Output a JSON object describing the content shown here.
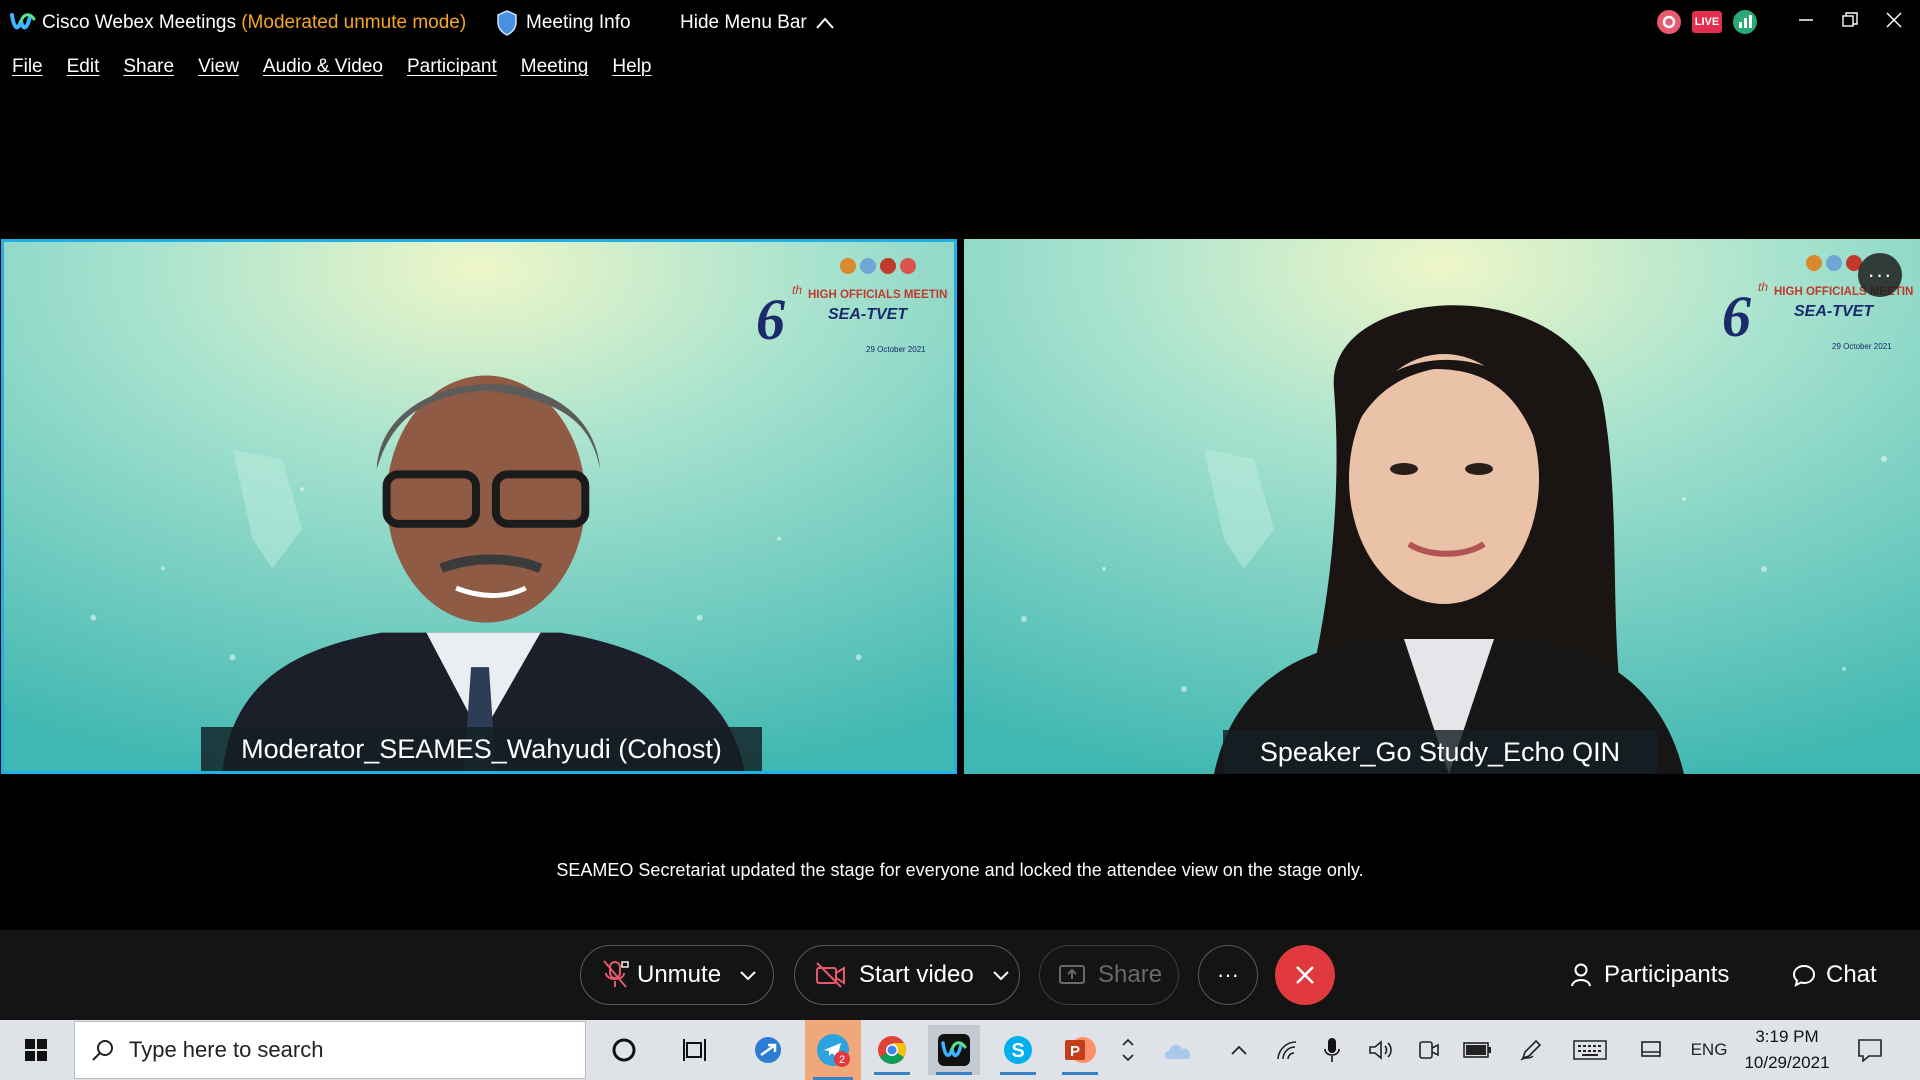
{
  "titlebar": {
    "app_name": "Cisco Webex Meetings",
    "mode": "(Moderated unmute mode)",
    "meeting_info": "Meeting Info",
    "hide_menu_bar": "Hide Menu Bar",
    "live_badge": "LIVE",
    "icons": [
      "webex-logo-icon",
      "shield-icon",
      "chevron-up-icon",
      "record-icon",
      "live-icon",
      "stats-icon",
      "minimize-icon",
      "restore-icon",
      "close-icon"
    ],
    "mode_color": "#f5a623"
  },
  "menubar": {
    "items": [
      "File",
      "Edit",
      "Share",
      "View",
      "Audio & Video",
      "Participant",
      "Meeting",
      "Help"
    ]
  },
  "video": {
    "left": {
      "name": "Moderator_SEAMES_Wahyudi  (Cohost)",
      "active_border": "#1fb0e8"
    },
    "right": {
      "name": "Speaker_Go Study_Echo QIN",
      "more": "···"
    },
    "event_logo": {
      "number": "6",
      "superscript": "th",
      "line1": "HIGH OFFICIALS MEETING",
      "line2": "SEA-TVET",
      "date": "29 October 2021"
    }
  },
  "notice": "SEAMEO Secretariat updated the stage for everyone and locked the attendee view on the stage only.",
  "controls": {
    "unmute": "Unmute",
    "start_video": "Start video",
    "share": "Share",
    "more": "···",
    "participants": "Participants",
    "chat": "Chat",
    "end_color": "#e03a3e"
  },
  "taskbar": {
    "search_placeholder": "Type here to search",
    "telegram_badge": "2",
    "language": "ENG",
    "time": "3:19 PM",
    "date": "10/29/2021"
  }
}
